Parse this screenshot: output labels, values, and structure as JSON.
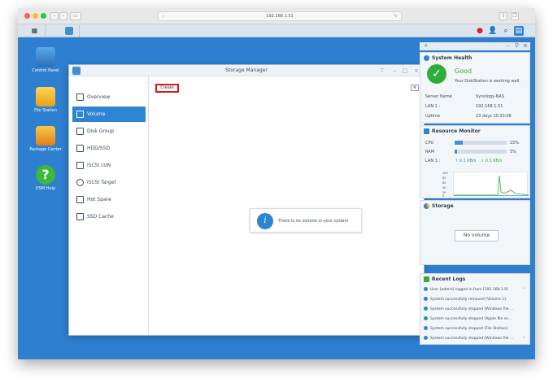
{
  "browser": {
    "url": "192.168.1.51",
    "reload_icon": "reload-icon"
  },
  "desktop": {
    "icons": [
      {
        "label": "Control Panel"
      },
      {
        "label": "File Station"
      },
      {
        "label": "Package Center"
      },
      {
        "label": "DSM Help"
      }
    ]
  },
  "storage_manager": {
    "title": "Storage Manager",
    "sidebar": [
      {
        "label": "Overview",
        "active": false
      },
      {
        "label": "Volume",
        "active": true
      },
      {
        "label": "Disk Group",
        "active": false
      },
      {
        "label": "HDD/SSD",
        "active": false
      },
      {
        "label": "iSCSI LUN",
        "active": false
      },
      {
        "label": "iSCSI Target",
        "active": false
      },
      {
        "label": "Hot Spare",
        "active": false
      },
      {
        "label": "SSD Cache",
        "active": false
      }
    ],
    "create_label": "Create",
    "empty_message": "There is no volume in your system"
  },
  "widgets": {
    "system_health": {
      "title": "System Health",
      "status": "Good",
      "message": "Your DiskStation is working well.",
      "server_name_label": "Server Name",
      "server_name": "Synology-NAS",
      "lan_label": "LAN 1 :",
      "lan_value": "192.168.1.51",
      "uptime_label": "Uptime",
      "uptime_value": "23 days 10:33:06"
    },
    "resource_monitor": {
      "title": "Resource Monitor",
      "cpu_label": "CPU",
      "cpu_value": "15%",
      "cpu_fraction": 0.15,
      "ram_label": "RAM",
      "ram_value": "5%",
      "ram_fraction": 0.05,
      "lan_label": "LAN 1 :",
      "lan_up": "0.1 KB/s",
      "lan_down": "0.1 KB/s",
      "chart_ticks": [
        "100",
        "80",
        "60",
        "40",
        "20",
        "0"
      ]
    },
    "storage": {
      "title": "Storage",
      "no_volume": "No volume"
    },
    "recent_logs": {
      "title": "Recent Logs",
      "items": [
        "User [admin] logged in from [192.168.1.9]",
        "System successfully removed [Volume 1].",
        "System successfully stopped [Windows file ...",
        "System successfully stopped [Apple file se...",
        "System successfully stopped [File Station].",
        "System successfully stopped [Windows file ..."
      ]
    }
  },
  "colors": {
    "accent": "#2d84d2",
    "highlight": "#e0171e",
    "good": "#2fad3a"
  }
}
